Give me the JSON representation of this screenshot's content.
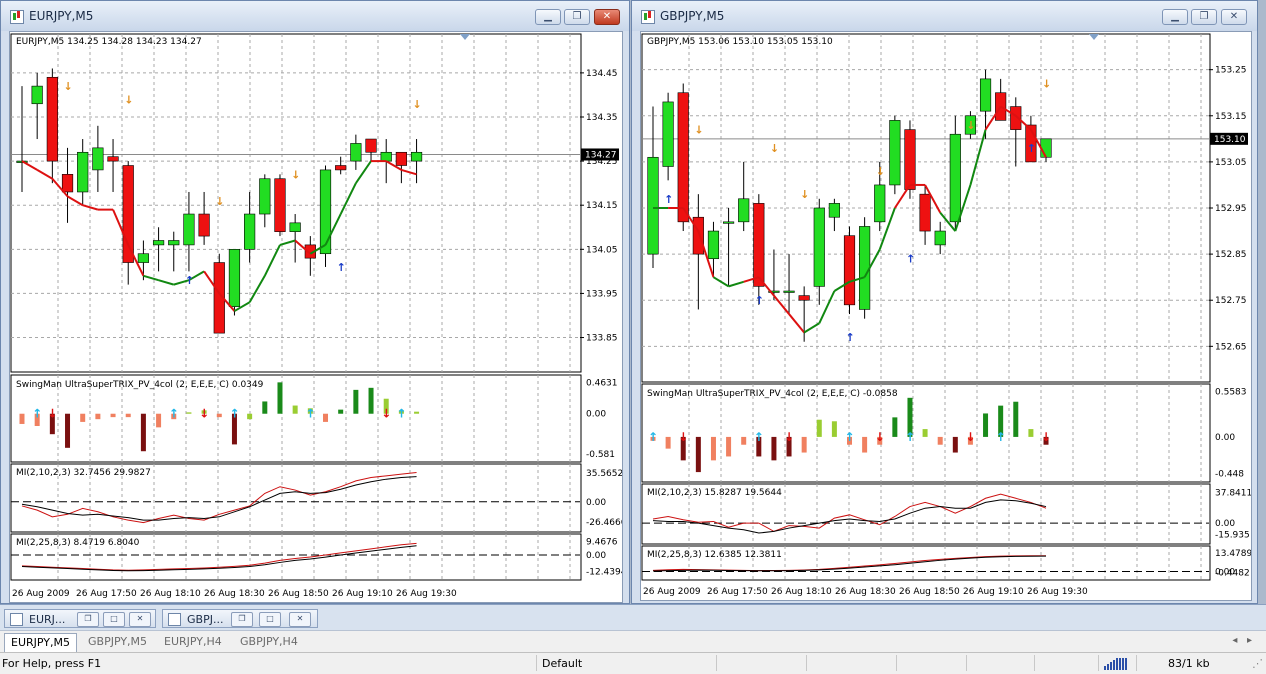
{
  "windows": [
    {
      "title": "EURJPY,M5",
      "header": "EURJPY,M5  134.25 134.28 134.23 134.27",
      "price": {
        "min": 133.79,
        "max": 134.52,
        "ticks": [
          "134.45",
          "134.35",
          "134.25",
          "134.15",
          "134.05",
          "133.95",
          "133.85"
        ],
        "tick_values": [
          134.45,
          134.35,
          134.25,
          134.15,
          134.05,
          133.95,
          133.85
        ],
        "current": "134.27",
        "current_value": 134.265
      },
      "candles": [
        [
          134.25,
          134.42,
          134.18,
          134.25
        ],
        [
          134.38,
          134.45,
          134.3,
          134.42
        ],
        [
          134.44,
          134.46,
          134.2,
          134.25
        ],
        [
          134.22,
          134.28,
          134.11,
          134.18
        ],
        [
          134.18,
          134.3,
          134.15,
          134.27
        ],
        [
          134.23,
          134.33,
          134.18,
          134.28
        ],
        [
          134.26,
          134.3,
          134.18,
          134.25
        ],
        [
          134.24,
          134.25,
          133.97,
          134.02
        ],
        [
          134.02,
          134.07,
          133.98,
          134.04
        ],
        [
          134.06,
          134.1,
          134.0,
          134.07
        ],
        [
          134.06,
          134.09,
          134.0,
          134.07
        ],
        [
          134.06,
          134.18,
          134.0,
          134.13
        ],
        [
          134.13,
          134.18,
          134.06,
          134.08
        ],
        [
          134.02,
          134.04,
          133.89,
          133.86
        ],
        [
          133.92,
          134.05,
          133.9,
          134.05
        ],
        [
          134.05,
          134.18,
          134.02,
          134.13
        ],
        [
          134.13,
          134.22,
          134.1,
          134.21
        ],
        [
          134.21,
          134.22,
          134.08,
          134.09
        ],
        [
          134.09,
          134.13,
          134.02,
          134.11
        ],
        [
          134.06,
          134.08,
          133.99,
          134.03
        ],
        [
          134.04,
          134.24,
          134.01,
          134.23
        ],
        [
          134.24,
          134.26,
          134.22,
          134.23
        ],
        [
          134.25,
          134.31,
          134.23,
          134.29
        ],
        [
          134.3,
          134.3,
          134.25,
          134.27
        ],
        [
          134.25,
          134.3,
          134.2,
          134.27
        ],
        [
          134.27,
          134.27,
          134.2,
          134.24
        ],
        [
          134.25,
          134.3,
          134.2,
          134.27
        ]
      ],
      "trix_line": [
        134.25,
        134.23,
        134.21,
        134.17,
        134.15,
        134.14,
        134.14,
        134.06,
        133.99,
        133.98,
        133.97,
        133.98,
        134.0,
        133.95,
        133.91,
        133.93,
        133.99,
        134.06,
        134.07,
        134.04,
        134.06,
        134.13,
        134.2,
        134.25,
        134.25,
        134.23,
        134.22
      ],
      "trix_colors": [
        "red",
        "red",
        "red",
        "red",
        "red",
        "red",
        "red",
        "red",
        "red",
        "green",
        "green",
        "green",
        "green",
        "red",
        "red",
        "green",
        "green",
        "green",
        "green",
        "red",
        "green",
        "green",
        "green",
        "green",
        "red",
        "red",
        "red"
      ],
      "arrows": [
        [
          3,
          134.42,
          "down",
          "#e09020"
        ],
        [
          7,
          134.39,
          "down",
          "#e09020"
        ],
        [
          11,
          133.98,
          "up",
          "#1a3cc8"
        ],
        [
          13,
          134.16,
          "down",
          "#e09020"
        ],
        [
          18,
          134.22,
          "down",
          "#e09020"
        ],
        [
          21,
          134.01,
          "up",
          "#1a3cc8"
        ],
        [
          26,
          134.38,
          "down",
          "#e09020"
        ]
      ],
      "indicator1": {
        "label": "SwingMan UltraSuperTRIX_PV_4col (2, E,E,E, C) 0.0349",
        "ticks": [
          "0.4631",
          "0.00",
          "-0.581"
        ],
        "range": [
          -0.62,
          0.48
        ],
        "values": [
          -0.15,
          -0.18,
          -0.3,
          -0.5,
          -0.12,
          -0.08,
          -0.05,
          -0.05,
          -0.55,
          -0.2,
          -0.08,
          0.02,
          0.05,
          -0.05,
          -0.45,
          -0.08,
          0.18,
          0.46,
          0.12,
          0.08,
          -0.12,
          0.06,
          0.35,
          0.38,
          0.22,
          0.05,
          0.03
        ],
        "colors": [
          "#f08060",
          "#f08060",
          "#7a1010",
          "#7a1010",
          "#f08060",
          "#f08060",
          "#f08060",
          "#f08060",
          "#7a1010",
          "#f08060",
          "#f08060",
          "#9acd32",
          "#9acd32",
          "#f08060",
          "#7a1010",
          "#9acd32",
          "#1a8a1a",
          "#1a8a1a",
          "#9acd32",
          "#9acd32",
          "#f08060",
          "#1a8a1a",
          "#1a8a1a",
          "#1a8a1a",
          "#9acd32",
          "#9acd32",
          "#9acd32"
        ],
        "signals": [
          [
            1,
            "up"
          ],
          [
            2,
            "down"
          ],
          [
            10,
            "up"
          ],
          [
            12,
            "down"
          ],
          [
            14,
            "up"
          ],
          [
            19,
            "up"
          ],
          [
            24,
            "down"
          ],
          [
            25,
            "up"
          ]
        ]
      },
      "indicator2": {
        "label": "MI(2,10,2,3) 32.7456 29.9827",
        "ticks": [
          "35.5652",
          "0.00",
          "-26.4666"
        ],
        "range": [
          -29,
          38
        ],
        "red": [
          -5,
          -10,
          -18,
          -15,
          -8,
          -12,
          -18,
          -22,
          -25,
          -20,
          -16,
          -20,
          -22,
          -15,
          -10,
          -5,
          10,
          18,
          14,
          8,
          12,
          18,
          25,
          29,
          31,
          33,
          35
        ],
        "black": [
          -3,
          -6,
          -10,
          -14,
          -16,
          -15,
          -17,
          -19,
          -22,
          -22,
          -20,
          -19,
          -20,
          -18,
          -12,
          -6,
          2,
          10,
          12,
          10,
          11,
          15,
          20,
          24,
          27,
          29,
          30
        ]
      },
      "indicator3": {
        "label": "MI(2,25,8,3) 8.4719 6.8040",
        "ticks": [
          "9.4676",
          "0.00",
          "-12.4394"
        ],
        "range": [
          -14,
          11
        ],
        "red": [
          -8,
          -8.5,
          -9,
          -9.5,
          -10,
          -10.5,
          -11,
          -11.2,
          -11,
          -10.6,
          -10.2,
          -10,
          -9.6,
          -9,
          -8.4,
          -7.6,
          -6,
          -4,
          -2.6,
          -1.5,
          0,
          1.5,
          3,
          4.5,
          6,
          7.5,
          8.5
        ],
        "black": [
          -8.5,
          -9,
          -9.5,
          -10,
          -10.5,
          -11,
          -11.4,
          -11.6,
          -11.5,
          -11.2,
          -10.9,
          -10.6,
          -10.2,
          -9.8,
          -9.2,
          -8.5,
          -7.2,
          -5.5,
          -4,
          -3,
          -1.6,
          0,
          1.4,
          2.8,
          4.2,
          5.6,
          6.8
        ]
      },
      "time_labels": [
        "26 Aug 2009",
        "26 Aug 17:50",
        "26 Aug 18:10",
        "26 Aug 18:30",
        "26 Aug 18:50",
        "26 Aug 19:10",
        "26 Aug 19:30"
      ]
    },
    {
      "title": "GBPJPY,M5",
      "header": "GBPJPY,M5  153.06 153.10 153.05 153.10",
      "price": {
        "min": 152.59,
        "max": 153.31,
        "ticks": [
          "153.25",
          "153.15",
          "153.05",
          "152.95",
          "152.85",
          "152.75",
          "152.65"
        ],
        "tick_values": [
          153.25,
          153.15,
          153.05,
          152.95,
          152.85,
          152.75,
          152.65
        ],
        "current": "153.10",
        "current_value": 153.1
      },
      "candles": [
        [
          152.85,
          153.17,
          152.82,
          153.06
        ],
        [
          153.04,
          153.2,
          153.01,
          153.18
        ],
        [
          153.2,
          153.22,
          152.9,
          152.92
        ],
        [
          152.93,
          152.98,
          152.73,
          152.85
        ],
        [
          152.84,
          152.92,
          152.8,
          152.9
        ],
        [
          152.92,
          152.95,
          152.78,
          152.92
        ],
        [
          152.92,
          153.05,
          152.9,
          152.97
        ],
        [
          152.96,
          152.98,
          152.74,
          152.78
        ],
        [
          152.77,
          152.86,
          152.75,
          152.77
        ],
        [
          152.77,
          152.85,
          152.72,
          152.77
        ],
        [
          152.76,
          152.78,
          152.66,
          152.75
        ],
        [
          152.78,
          152.97,
          152.74,
          152.95
        ],
        [
          152.93,
          152.97,
          152.9,
          152.96
        ],
        [
          152.89,
          152.91,
          152.72,
          152.74
        ],
        [
          152.73,
          152.93,
          152.71,
          152.91
        ],
        [
          152.92,
          153.05,
          152.9,
          153.0
        ],
        [
          153.0,
          153.15,
          152.98,
          153.14
        ],
        [
          153.12,
          153.14,
          152.97,
          152.99
        ],
        [
          152.98,
          153.0,
          152.87,
          152.9
        ],
        [
          152.87,
          152.92,
          152.85,
          152.9
        ],
        [
          152.92,
          153.15,
          152.9,
          153.11
        ],
        [
          153.11,
          153.16,
          153.1,
          153.15
        ],
        [
          153.16,
          153.25,
          153.1,
          153.23
        ],
        [
          153.2,
          153.23,
          153.14,
          153.14
        ],
        [
          153.17,
          153.19,
          153.04,
          153.12
        ],
        [
          153.13,
          153.15,
          153.05,
          153.05
        ],
        [
          153.06,
          153.1,
          153.05,
          153.1
        ]
      ],
      "trix_line": [
        152.95,
        152.95,
        152.95,
        152.9,
        152.8,
        152.78,
        152.79,
        152.8,
        152.76,
        152.72,
        152.68,
        152.7,
        152.77,
        152.79,
        152.8,
        152.86,
        152.95,
        153.0,
        153.0,
        152.94,
        152.9,
        153.0,
        153.12,
        153.17,
        153.15,
        153.12,
        153.06
      ],
      "trix_colors": [
        "green",
        "green",
        "red",
        "red",
        "red",
        "green",
        "green",
        "red",
        "red",
        "red",
        "red",
        "green",
        "green",
        "green",
        "green",
        "green",
        "green",
        "red",
        "red",
        "red",
        "green",
        "green",
        "green",
        "red",
        "red",
        "red",
        "red"
      ],
      "arrows": [
        [
          1,
          152.97,
          "up",
          "#1a3cc8"
        ],
        [
          3,
          153.12,
          "down",
          "#e09020"
        ],
        [
          7,
          152.75,
          "up",
          "#1a3cc8"
        ],
        [
          8,
          153.08,
          "down",
          "#e09020"
        ],
        [
          10,
          152.98,
          "down",
          "#e09020"
        ],
        [
          13,
          152.67,
          "up",
          "#1a3cc8"
        ],
        [
          15,
          153.03,
          "down",
          "#e09020"
        ],
        [
          17,
          152.84,
          "up",
          "#1a3cc8"
        ],
        [
          21,
          153.13,
          "down",
          "#e09020"
        ],
        [
          25,
          153.08,
          "up",
          "#1a3cc8"
        ],
        [
          28,
          153.22,
          "down",
          "#e09020"
        ]
      ],
      "indicator1": {
        "label": "SwingMan UltraSuperTRIX_PV_4col (2, E,E,E, C) -0.0858",
        "ticks": [
          "0.5583",
          "0.00",
          "-0.448"
        ],
        "range": [
          -0.5,
          0.6
        ],
        "values": [
          -0.05,
          -0.15,
          -0.3,
          -0.45,
          -0.3,
          -0.25,
          -0.1,
          -0.25,
          -0.3,
          -0.25,
          -0.2,
          0.22,
          0.2,
          -0.1,
          -0.2,
          -0.1,
          0.25,
          0.5,
          0.1,
          -0.1,
          -0.2,
          -0.1,
          0.3,
          0.4,
          0.45,
          0.1,
          -0.1,
          -0.12
        ],
        "colors": [
          "#f08060",
          "#f08060",
          "#7a1010",
          "#7a1010",
          "#f08060",
          "#f08060",
          "#f08060",
          "#7a1010",
          "#7a1010",
          "#7a1010",
          "#f08060",
          "#9acd32",
          "#9acd32",
          "#f08060",
          "#f08060",
          "#f08060",
          "#1a8a1a",
          "#1a8a1a",
          "#9acd32",
          "#f08060",
          "#7a1010",
          "#f08060",
          "#1a8a1a",
          "#1a8a1a",
          "#1a8a1a",
          "#9acd32",
          "#7a1010",
          "#f08060"
        ],
        "signals": [
          [
            0,
            "up"
          ],
          [
            2,
            "down"
          ],
          [
            7,
            "up"
          ],
          [
            9,
            "down"
          ],
          [
            13,
            "up"
          ],
          [
            15,
            "down"
          ],
          [
            17,
            "up"
          ],
          [
            21,
            "down"
          ],
          [
            23,
            "up"
          ],
          [
            27,
            "down"
          ]
        ]
      },
      "indicator2": {
        "label": "MI(2,10,2,3) 15.8287 19.5644",
        "ticks": [
          "37.8411",
          "0.00",
          "-15.935"
        ],
        "range": [
          -18,
          40
        ],
        "red": [
          5,
          8,
          4,
          1,
          2,
          -5,
          0,
          0,
          -10,
          -3,
          -4,
          -6,
          6,
          10,
          4,
          -2,
          8,
          20,
          25,
          20,
          12,
          20,
          30,
          35,
          30,
          25,
          18
        ],
        "black": [
          3,
          2,
          2,
          0,
          -3,
          -6,
          -8,
          -12,
          -10,
          -6,
          -3,
          0,
          3,
          5,
          3,
          2,
          5,
          12,
          18,
          20,
          18,
          18,
          25,
          28,
          27,
          24,
          20
        ]
      },
      "indicator3": {
        "label": "MI(2,25,8,3) 12.6385 12.3811",
        "ticks": [
          "13.4789",
          "0.00",
          "-0.4482"
        ],
        "range": [
          -2,
          16
        ],
        "red": [
          1,
          1.5,
          1.8,
          1.6,
          1.4,
          1.2,
          1.0,
          0.8,
          0.9,
          1.0,
          1.3,
          1.8,
          2.6,
          3.5,
          4.5,
          5.5,
          6.6,
          7.8,
          9,
          10,
          10.8,
          11.5,
          12.2,
          12.6,
          12.8,
          12.9,
          12.9
        ],
        "black": [
          0.5,
          0.8,
          1.0,
          1.2,
          1.1,
          0.9,
          0.8,
          0.7,
          0.7,
          0.8,
          1.0,
          1.4,
          2.0,
          2.8,
          3.7,
          4.6,
          5.6,
          6.8,
          8,
          9.2,
          10.2,
          11,
          11.7,
          12.1,
          12.4,
          12.5,
          12.6
        ]
      },
      "time_labels": [
        "26 Aug 2009",
        "26 Aug 17:50",
        "26 Aug 18:10",
        "26 Aug 18:30",
        "26 Aug 18:50",
        "26 Aug 19:10",
        "26 Aug 19:30"
      ]
    }
  ],
  "tray": [
    {
      "label": "EURJ..."
    },
    {
      "label": "GBPJ..."
    }
  ],
  "tabs": [
    {
      "label": "EURJPY,M5"
    },
    {
      "label": "GBPJPY,M5"
    },
    {
      "label": "EURJPY,H4"
    },
    {
      "label": "GBPJPY,H4"
    }
  ],
  "status": {
    "help": "For Help, press F1",
    "profile": "Default",
    "traffic": "83/1 kb"
  },
  "icons": {
    "minimize": "minimize-icon",
    "maximize": "maximize-icon",
    "close": "close-icon"
  }
}
